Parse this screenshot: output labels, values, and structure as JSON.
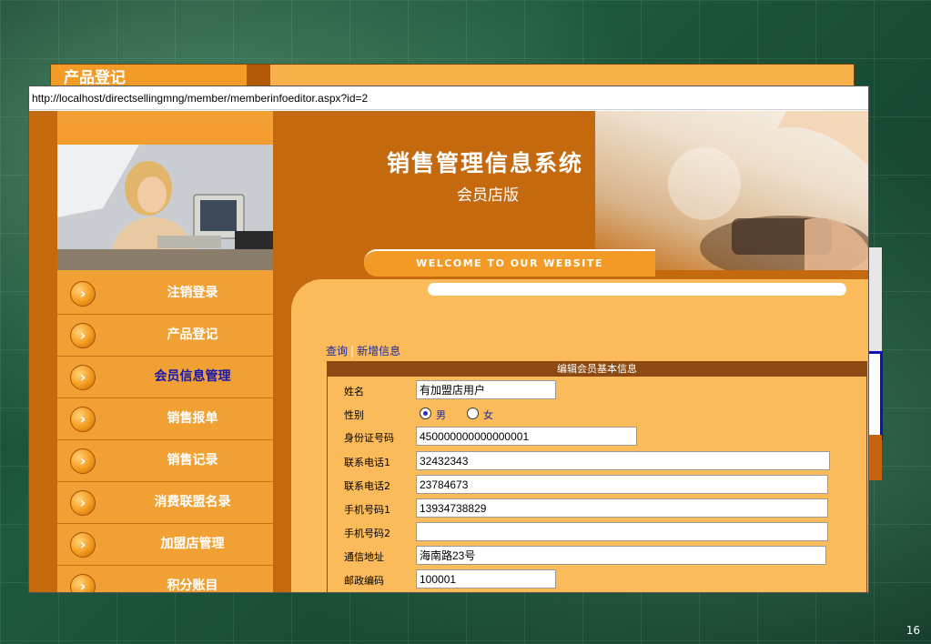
{
  "slide_number": "16",
  "background_window": {
    "title": "产品登记"
  },
  "window": {
    "url": "http://localhost/directsellingmng/member/memberinfoeditor.aspx?id=2"
  },
  "header": {
    "title": "销售管理信息系统",
    "subtitle": "会员店版",
    "welcome": "WELCOME TO OUR WEBSITE"
  },
  "sidebar": {
    "items": [
      {
        "label": "注销登录",
        "active": false
      },
      {
        "label": "产品登记",
        "active": false
      },
      {
        "label": "会员信息管理",
        "active": true
      },
      {
        "label": "销售报单",
        "active": false
      },
      {
        "label": "销售记录",
        "active": false
      },
      {
        "label": "消费联盟名录",
        "active": false
      },
      {
        "label": "加盟店管理",
        "active": false
      },
      {
        "label": "积分账目",
        "active": false
      }
    ]
  },
  "links": {
    "query": "查询",
    "separator": "|",
    "add": "新增信息"
  },
  "form": {
    "title": "编辑会员基本信息",
    "fields": {
      "name": {
        "label": "姓名",
        "value": "有加盟店用户"
      },
      "gender": {
        "label": "性别",
        "male": "男",
        "female": "女",
        "selected": "男"
      },
      "id_number": {
        "label": "身份证号码",
        "value": "450000000000000001"
      },
      "phone1": {
        "label": "联系电话1",
        "value": "32432343"
      },
      "phone2": {
        "label": "联系电话2",
        "value": "23784673"
      },
      "mobile1": {
        "label": "手机号码1",
        "value": "13934738829"
      },
      "mobile2": {
        "label": "手机号码2",
        "value": ""
      },
      "address": {
        "label": "通信地址",
        "value": "海南路23号"
      },
      "postcode": {
        "label": "邮政编码",
        "value": "100001"
      }
    }
  },
  "colors": {
    "brand_orange": "#c4690d",
    "panel_orange": "#fbbb5a",
    "active_nav": "#1418b0",
    "form_header": "#8c4a12"
  }
}
